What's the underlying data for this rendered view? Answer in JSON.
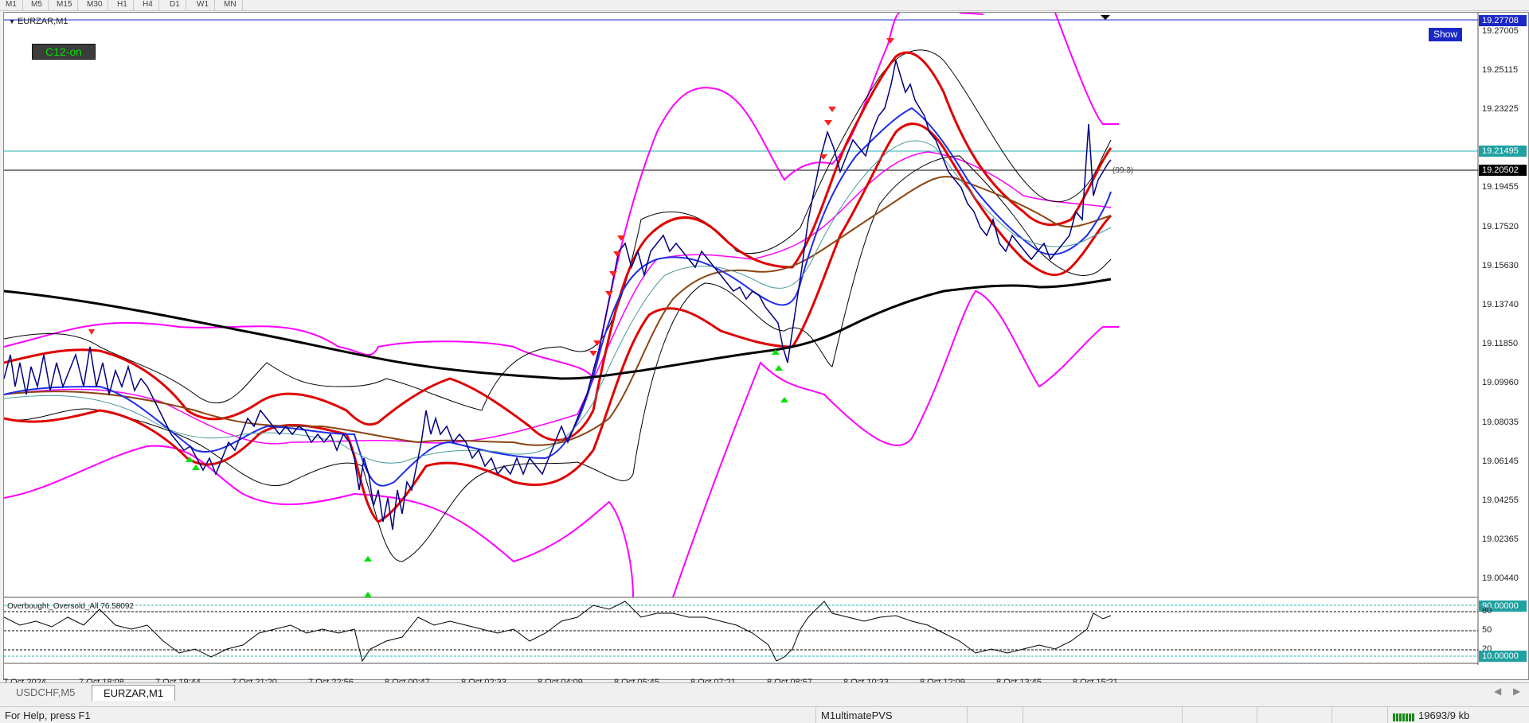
{
  "toolbar": {
    "timeframes": [
      "M1",
      "M5",
      "M15",
      "M30",
      "H1",
      "H4",
      "D1",
      "W1",
      "MN"
    ]
  },
  "chart": {
    "title": "EURZAR,M1",
    "indicator_button": "C12-on",
    "show_button": "Show",
    "bid_label": "(99.3)",
    "price_labels": [
      "19.27005",
      "19.25115",
      "19.23225",
      "19.19455",
      "19.17520",
      "19.15630",
      "19.13740",
      "19.11850",
      "19.09960",
      "19.08035",
      "19.06145",
      "19.04255",
      "19.02365",
      "19.00440"
    ],
    "price_tags": {
      "top": "19.27708",
      "cyan": "19.21495",
      "black": "19.20502"
    },
    "oscillator": {
      "title": "Overbought_Oversold_All 76.58092",
      "levels": [
        "80",
        "50",
        "20"
      ],
      "tag_top": "90.00000",
      "tag_bottom": "10.00000"
    },
    "time_labels": [
      "7 Oct 2024",
      "7 Oct 18:08",
      "7 Oct 19:44",
      "7 Oct 21:20",
      "7 Oct 22:56",
      "8 Oct 00:47",
      "8 Oct 02:33",
      "8 Oct 04:09",
      "8 Oct 05:45",
      "8 Oct 07:21",
      "8 Oct 08:57",
      "8 Oct 10:33",
      "8 Oct 12:09",
      "8 Oct 13:45",
      "8 Oct 15:21"
    ]
  },
  "tabs": [
    {
      "label": "USDCHF,M5",
      "active": false
    },
    {
      "label": "EURZAR,M1",
      "active": true
    }
  ],
  "status": {
    "help": "For Help, press F1",
    "profile": "M1ultimatePVS",
    "traffic": "19693/9 kb"
  },
  "colors": {
    "price": "#000080",
    "band_red": "#e00000",
    "band_magenta": "#ff00ff",
    "ma_blue": "#1e2ee8",
    "ma_brown": "#8b4513",
    "ma_black": "#000000",
    "signal_green": "#00e000",
    "cyan_line": "#00b0b0",
    "tag_blue": "#1a28c8",
    "tag_cyan": "#20a0a0"
  }
}
